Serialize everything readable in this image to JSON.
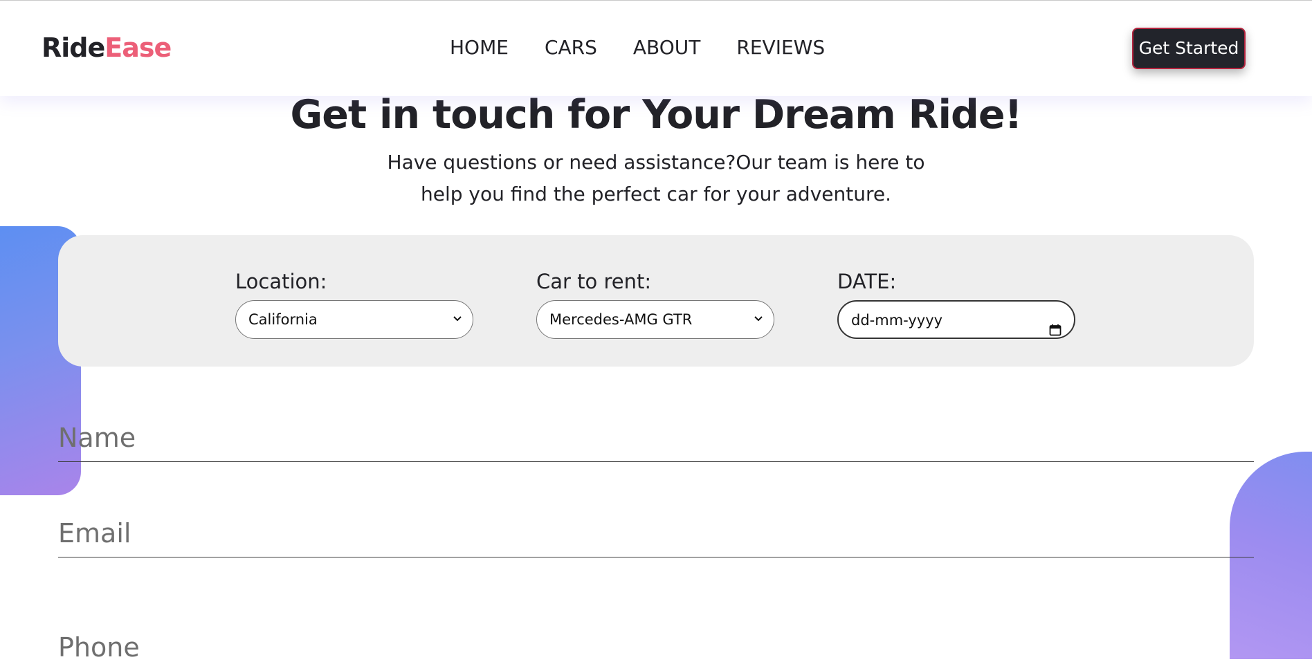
{
  "brand": {
    "name_part_a": "Ride",
    "name_part_b": "Ease",
    "accent_color": "#ec5f78",
    "dark_color": "#222227"
  },
  "nav": {
    "links": [
      {
        "label": "HOME"
      },
      {
        "label": "CARS"
      },
      {
        "label": "ABOUT"
      },
      {
        "label": "REVIEWS"
      }
    ],
    "cta_label": "Get Started"
  },
  "hero": {
    "title": "Get in touch for Your Dream Ride!",
    "subtitle_line1": "Have questions or need assistance?Our team is here to",
    "subtitle_line2": "help you find the perfect car for your adventure."
  },
  "booking": {
    "location": {
      "label": "Location:",
      "value": "California",
      "icon": "chevron-down-icon"
    },
    "car": {
      "label": "Car to rent:",
      "value": "Mercedes-AMG GTR",
      "icon": "chevron-down-icon"
    },
    "date": {
      "label": "DATE:",
      "placeholder": "dd-mm-yyyy",
      "icon": "calendar-icon"
    }
  },
  "contact": {
    "name_placeholder": "Name",
    "email_placeholder": "Email",
    "phone_placeholder": "Phone"
  },
  "decor": {
    "blob_gradient_start": "#5b8ff2",
    "blob_gradient_end": "#a984ea"
  }
}
